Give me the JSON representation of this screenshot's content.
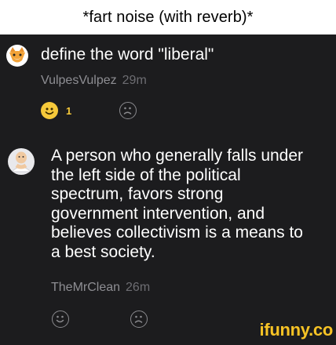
{
  "caption": "*fart noise (with reverb)*",
  "comments": [
    {
      "text": "define the word \"liberal\"",
      "username": "VulpesVulpez",
      "time": "29m",
      "smile_count": "1"
    },
    {
      "text_lines": [
        "A person who generally falls under",
        "the left side of the political",
        "spectrum, favors strong",
        "government intervention, and",
        "believes collectivism is a means to",
        "a best society."
      ],
      "username": "TheMrClean",
      "time": "26m"
    }
  ],
  "icons": {
    "smile": "smile-icon",
    "frown": "frown-icon"
  },
  "colors": {
    "background": "#1c1c1e",
    "accent": "#f6c93a"
  },
  "watermark": "ifunny.co"
}
